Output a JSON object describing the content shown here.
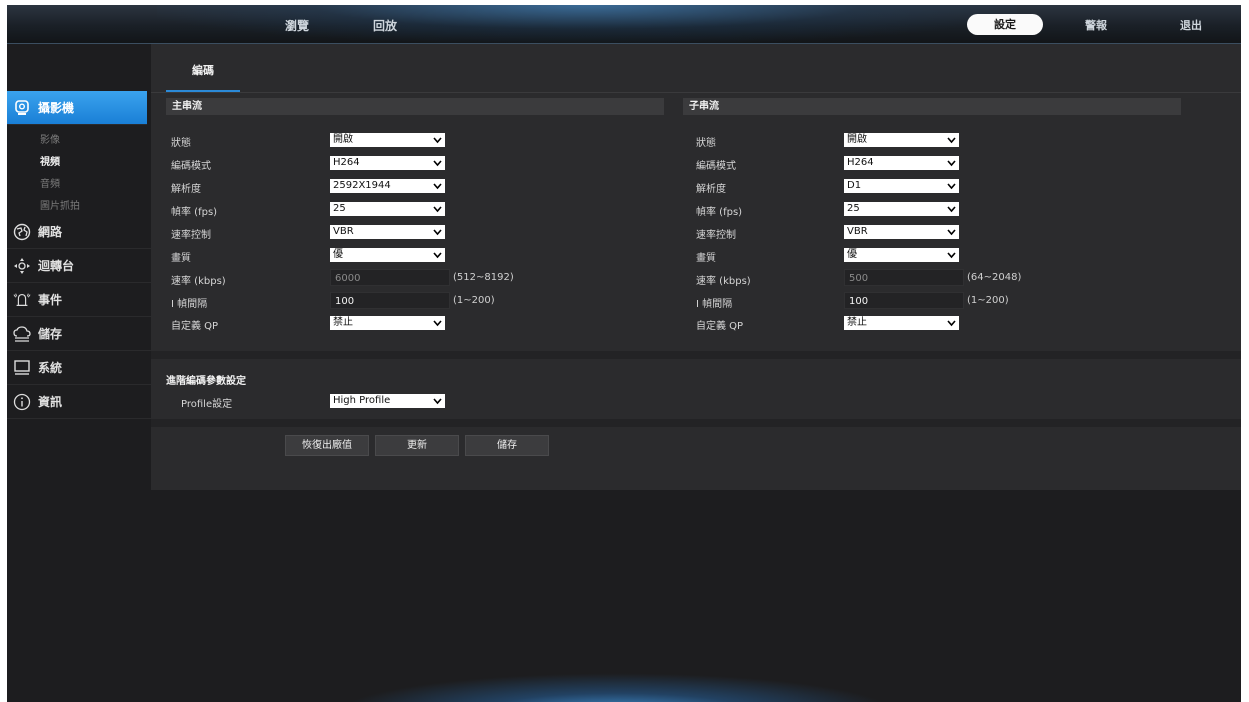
{
  "header": {
    "nav_left": [
      "瀏覽",
      "回放"
    ],
    "nav_settings": "設定",
    "nav_alarm": "警報",
    "nav_logout": "退出"
  },
  "sidebar": {
    "items": [
      {
        "label": "攝影機",
        "icon": "camera-icon",
        "active": true
      },
      {
        "label": "網路",
        "icon": "network-globe-icon"
      },
      {
        "label": "迴轉台",
        "icon": "ptz-icon"
      },
      {
        "label": "事件",
        "icon": "alarm-bell-icon"
      },
      {
        "label": "儲存",
        "icon": "storage-cloud-icon"
      },
      {
        "label": "系統",
        "icon": "monitor-icon"
      },
      {
        "label": "資訊",
        "icon": "info-icon"
      }
    ],
    "subitems": [
      {
        "label": "影像"
      },
      {
        "label": "視頻",
        "current": true
      },
      {
        "label": "音頻"
      },
      {
        "label": "圖片抓拍"
      }
    ]
  },
  "tab": {
    "label": "編碼"
  },
  "main_stream": {
    "title": "主串流",
    "fields": {
      "status": {
        "label": "狀態",
        "value": "開啟"
      },
      "encode_mode": {
        "label": "編碼模式",
        "value": "H264"
      },
      "resolution": {
        "label": "解析度",
        "value": "2592X1944"
      },
      "fps": {
        "label": "幀率 (fps)",
        "value": "25"
      },
      "rate_control": {
        "label": "速率控制",
        "value": "VBR"
      },
      "quality": {
        "label": "畫質",
        "value": "優"
      },
      "bitrate": {
        "label": "速率 (kbps)",
        "value": "6000",
        "range": "(512~8192)"
      },
      "i_interval": {
        "label": "I 幀間隔",
        "value": "100",
        "range": "(1~200)"
      },
      "custom_qp": {
        "label": "自定義 QP",
        "value": "禁止"
      }
    }
  },
  "sub_stream": {
    "title": "子串流",
    "fields": {
      "status": {
        "label": "狀態",
        "value": "開啟"
      },
      "encode_mode": {
        "label": "編碼模式",
        "value": "H264"
      },
      "resolution": {
        "label": "解析度",
        "value": "D1"
      },
      "fps": {
        "label": "幀率 (fps)",
        "value": "25"
      },
      "rate_control": {
        "label": "速率控制",
        "value": "VBR"
      },
      "quality": {
        "label": "畫質",
        "value": "優"
      },
      "bitrate": {
        "label": "速率 (kbps)",
        "value": "500",
        "range": "(64~2048)"
      },
      "i_interval": {
        "label": "I 幀間隔",
        "value": "100",
        "range": "(1~200)"
      },
      "custom_qp": {
        "label": "自定義 QP",
        "value": "禁止"
      }
    }
  },
  "advanced": {
    "title": "進階編碼參數設定",
    "profile_label": "Profile設定",
    "profile_value": "High Profile"
  },
  "buttons": {
    "restore": "恢復出廠值",
    "refresh": "更新",
    "save": "儲存"
  },
  "colors": {
    "accent": "#2b8ad8",
    "panel_bg": "#2b2b2d",
    "app_bg": "#1d1d1f"
  }
}
